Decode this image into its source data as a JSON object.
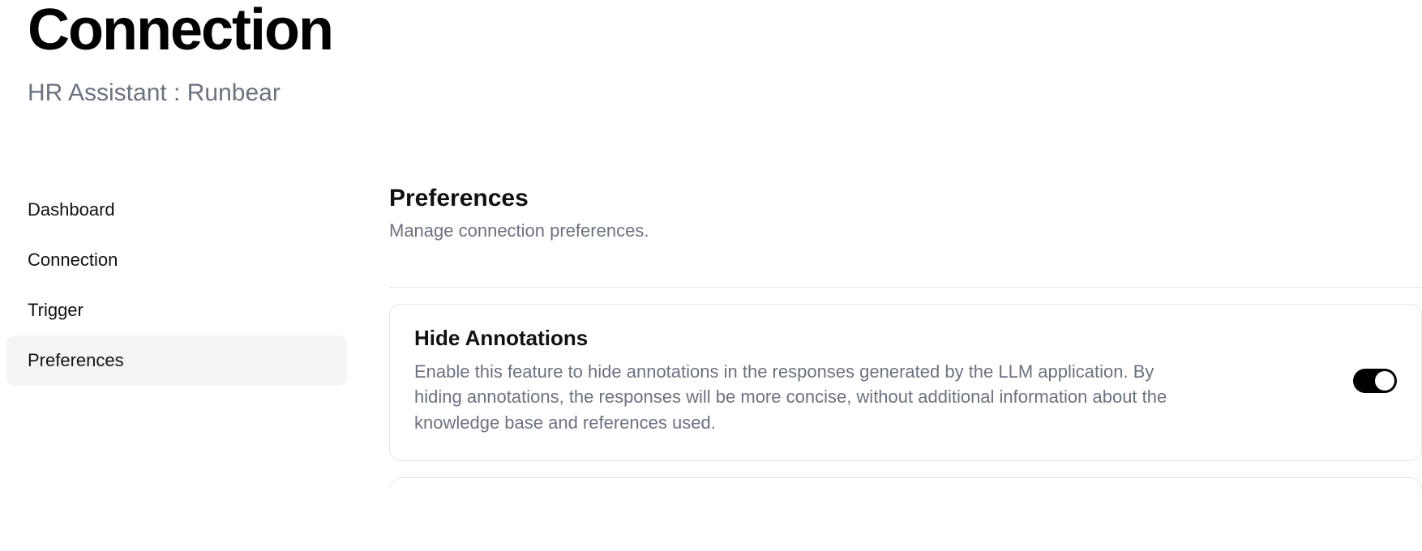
{
  "header": {
    "title": "Connection",
    "subtitle": "HR Assistant : Runbear"
  },
  "sidebar": {
    "items": [
      {
        "label": "Dashboard",
        "active": false
      },
      {
        "label": "Connection",
        "active": false
      },
      {
        "label": "Trigger",
        "active": false
      },
      {
        "label": "Preferences",
        "active": true
      }
    ]
  },
  "main": {
    "section_title": "Preferences",
    "section_desc": "Manage connection preferences.",
    "pref": {
      "title": "Hide Annotations",
      "desc": "Enable this feature to hide annotations in the responses generated by the LLM application. By hiding annotations, the responses will be more concise, without additional information about the knowledge base and references used.",
      "enabled": true
    }
  }
}
